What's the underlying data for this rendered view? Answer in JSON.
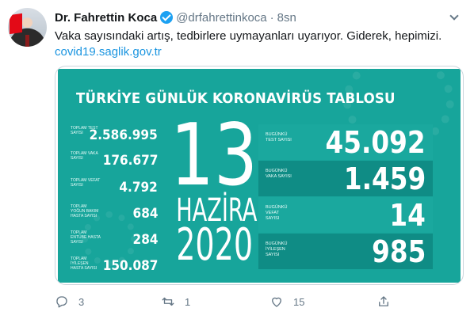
{
  "tweet": {
    "author_name": "Dr. Fahrettin Koca",
    "handle": "@drfahrettinkoca",
    "separator": "·",
    "time": "8sn",
    "text": "Vaka sayısındaki artış, tedbirlere uymayanları uyarıyor. Giderek, hepimizi.",
    "link": "covid19.saglik.gov.tr"
  },
  "card": {
    "title": "TÜRKİYE GÜNLÜK KORONAVİRÜS TABLOSU",
    "left_stats": [
      {
        "label": "TOPLAM TEST SAYISI",
        "value": "2.586.995"
      },
      {
        "label": "TOPLAM VAKA SAYISI",
        "value": "176.677"
      },
      {
        "label": "TOPLAM VEFAT SAYISI",
        "value": "4.792"
      },
      {
        "label": "TOPLAM YOĞUN BAKIM HASTA SAYISI",
        "value": "684"
      },
      {
        "label": "TOPLAM ENTÜBE HASTA SAYISI",
        "value": "284"
      },
      {
        "label": "TOPLAM İYİLEŞEN HASTA SAYISI",
        "value": "150.087"
      }
    ],
    "date": {
      "day": "13",
      "month": "HAZİRAN",
      "year": "2020"
    },
    "right_stats": [
      {
        "label": "BUGÜNKÜ TEST SAYISI",
        "value": "45.092"
      },
      {
        "label": "BUGÜNKÜ VAKA SAYISI",
        "value": "1.459"
      },
      {
        "label": "BUGÜNKÜ VEFAT SAYISI",
        "value": "14"
      },
      {
        "label": "BUGÜNKÜ İYİLEŞEN SAYISI",
        "value": "985"
      }
    ]
  },
  "actions": {
    "reply_count": "3",
    "retweet_count": "1",
    "like_count": "15"
  },
  "colors": {
    "card_teal": "#17a59b",
    "link_blue": "#1b95e0",
    "verified_blue": "#1da1f2"
  }
}
